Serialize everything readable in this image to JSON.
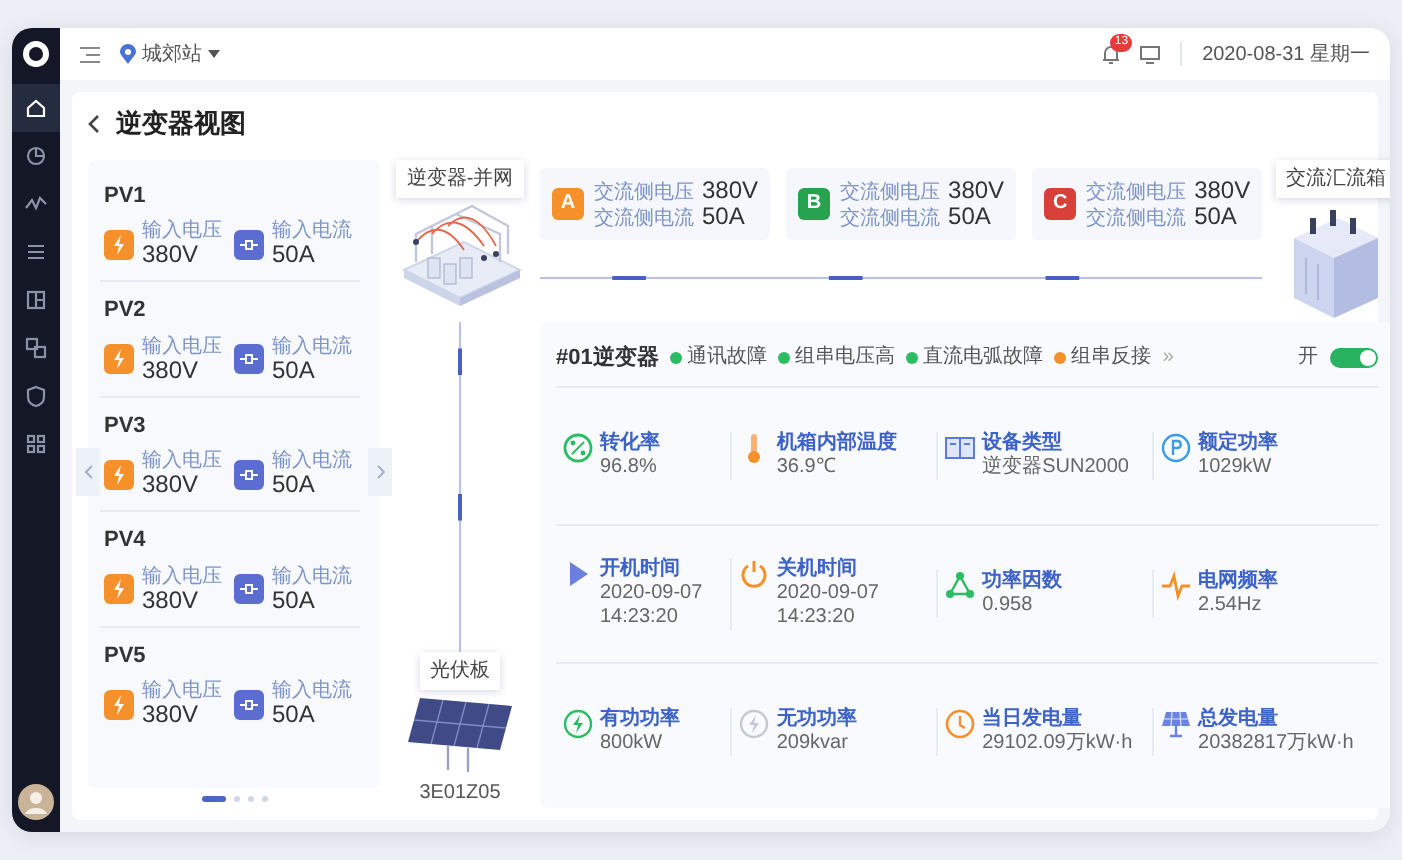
{
  "sidebar": {
    "items": [
      {
        "kind": "home",
        "selected": true
      },
      {
        "kind": "pie",
        "selected": false
      },
      {
        "kind": "pulse",
        "selected": false
      },
      {
        "kind": "list",
        "selected": false
      },
      {
        "kind": "layout",
        "selected": false
      },
      {
        "kind": "share",
        "selected": false
      },
      {
        "kind": "shield",
        "selected": false
      },
      {
        "kind": "grid",
        "selected": false
      }
    ]
  },
  "topbar": {
    "station": "城郊站",
    "notification_count": "13",
    "date": "2020-08-31 星期一"
  },
  "page_title": "逆变器视图",
  "pv_strings": [
    {
      "name": "PV1",
      "voltage_label": "输入电压",
      "voltage": "380V",
      "current_label": "输入电流",
      "current": "50A"
    },
    {
      "name": "PV2",
      "voltage_label": "输入电压",
      "voltage": "380V",
      "current_label": "输入电流",
      "current": "50A"
    },
    {
      "name": "PV3",
      "voltage_label": "输入电压",
      "voltage": "380V",
      "current_label": "输入电流",
      "current": "50A"
    },
    {
      "name": "PV4",
      "voltage_label": "输入电压",
      "voltage": "380V",
      "current_label": "输入电流",
      "current": "50A"
    },
    {
      "name": "PV5",
      "voltage_label": "输入电压",
      "voltage": "380V",
      "current_label": "输入电流",
      "current": "50A"
    }
  ],
  "pager": [
    {
      "selected": true
    },
    {
      "selected": false
    },
    {
      "selected": false
    },
    {
      "selected": false
    }
  ],
  "diagram": {
    "inverter_label": "逆变器-并网",
    "combiner_label": "交流汇流箱",
    "panel_label": "光伏板",
    "panel_id": "3E01Z05",
    "phases": [
      {
        "letter": "A",
        "color": "#f5902a",
        "voltage_label": "交流侧电压",
        "voltage": "380V",
        "current_label": "交流侧电流",
        "current": "50A"
      },
      {
        "letter": "B",
        "color": "#27a34f",
        "voltage_label": "交流侧电压",
        "voltage": "380V",
        "current_label": "交流侧电流",
        "current": "50A"
      },
      {
        "letter": "C",
        "color": "#d9403a",
        "voltage_label": "交流侧电压",
        "voltage": "380V",
        "current_label": "交流侧电流",
        "current": "50A"
      }
    ]
  },
  "inverter": {
    "title": "#01逆变器",
    "more": "»",
    "switch_label": "开",
    "switch_on": true,
    "alarms": [
      {
        "label": "通讯故障",
        "color": "#2bbd62"
      },
      {
        "label": "组串电压高",
        "color": "#2bbd62"
      },
      {
        "label": "直流电弧故障",
        "color": "#2bbd62"
      },
      {
        "label": "组串反接",
        "color": "#f5902a"
      }
    ],
    "metrics": [
      {
        "kind": "rate",
        "label": "转化率",
        "value": "96.8%"
      },
      {
        "kind": "temperature",
        "label": "机箱内部温度",
        "value": "36.9℃"
      },
      {
        "kind": "device",
        "label": "设备类型",
        "value": "逆变器SUN2000"
      },
      {
        "kind": "power",
        "label": "额定功率",
        "value": "1029kW"
      },
      {
        "kind": "start",
        "label": "开机时间",
        "value": "2020-09-07\n14:23:20"
      },
      {
        "kind": "stop",
        "label": "关机时间",
        "value": "2020-09-07\n14:23:20"
      },
      {
        "kind": "factor",
        "label": "功率因数",
        "value": "0.958"
      },
      {
        "kind": "frequency",
        "label": "电网频率",
        "value": "2.54Hz"
      },
      {
        "kind": "active",
        "label": "有功功率",
        "value": "800kW"
      },
      {
        "kind": "reactive",
        "label": "无功功率",
        "value": "209kvar"
      },
      {
        "kind": "daily",
        "label": "当日发电量",
        "value": "29102.09万kW·h"
      },
      {
        "kind": "total",
        "label": "总发电量",
        "value": "20382817万kW·h"
      }
    ]
  }
}
